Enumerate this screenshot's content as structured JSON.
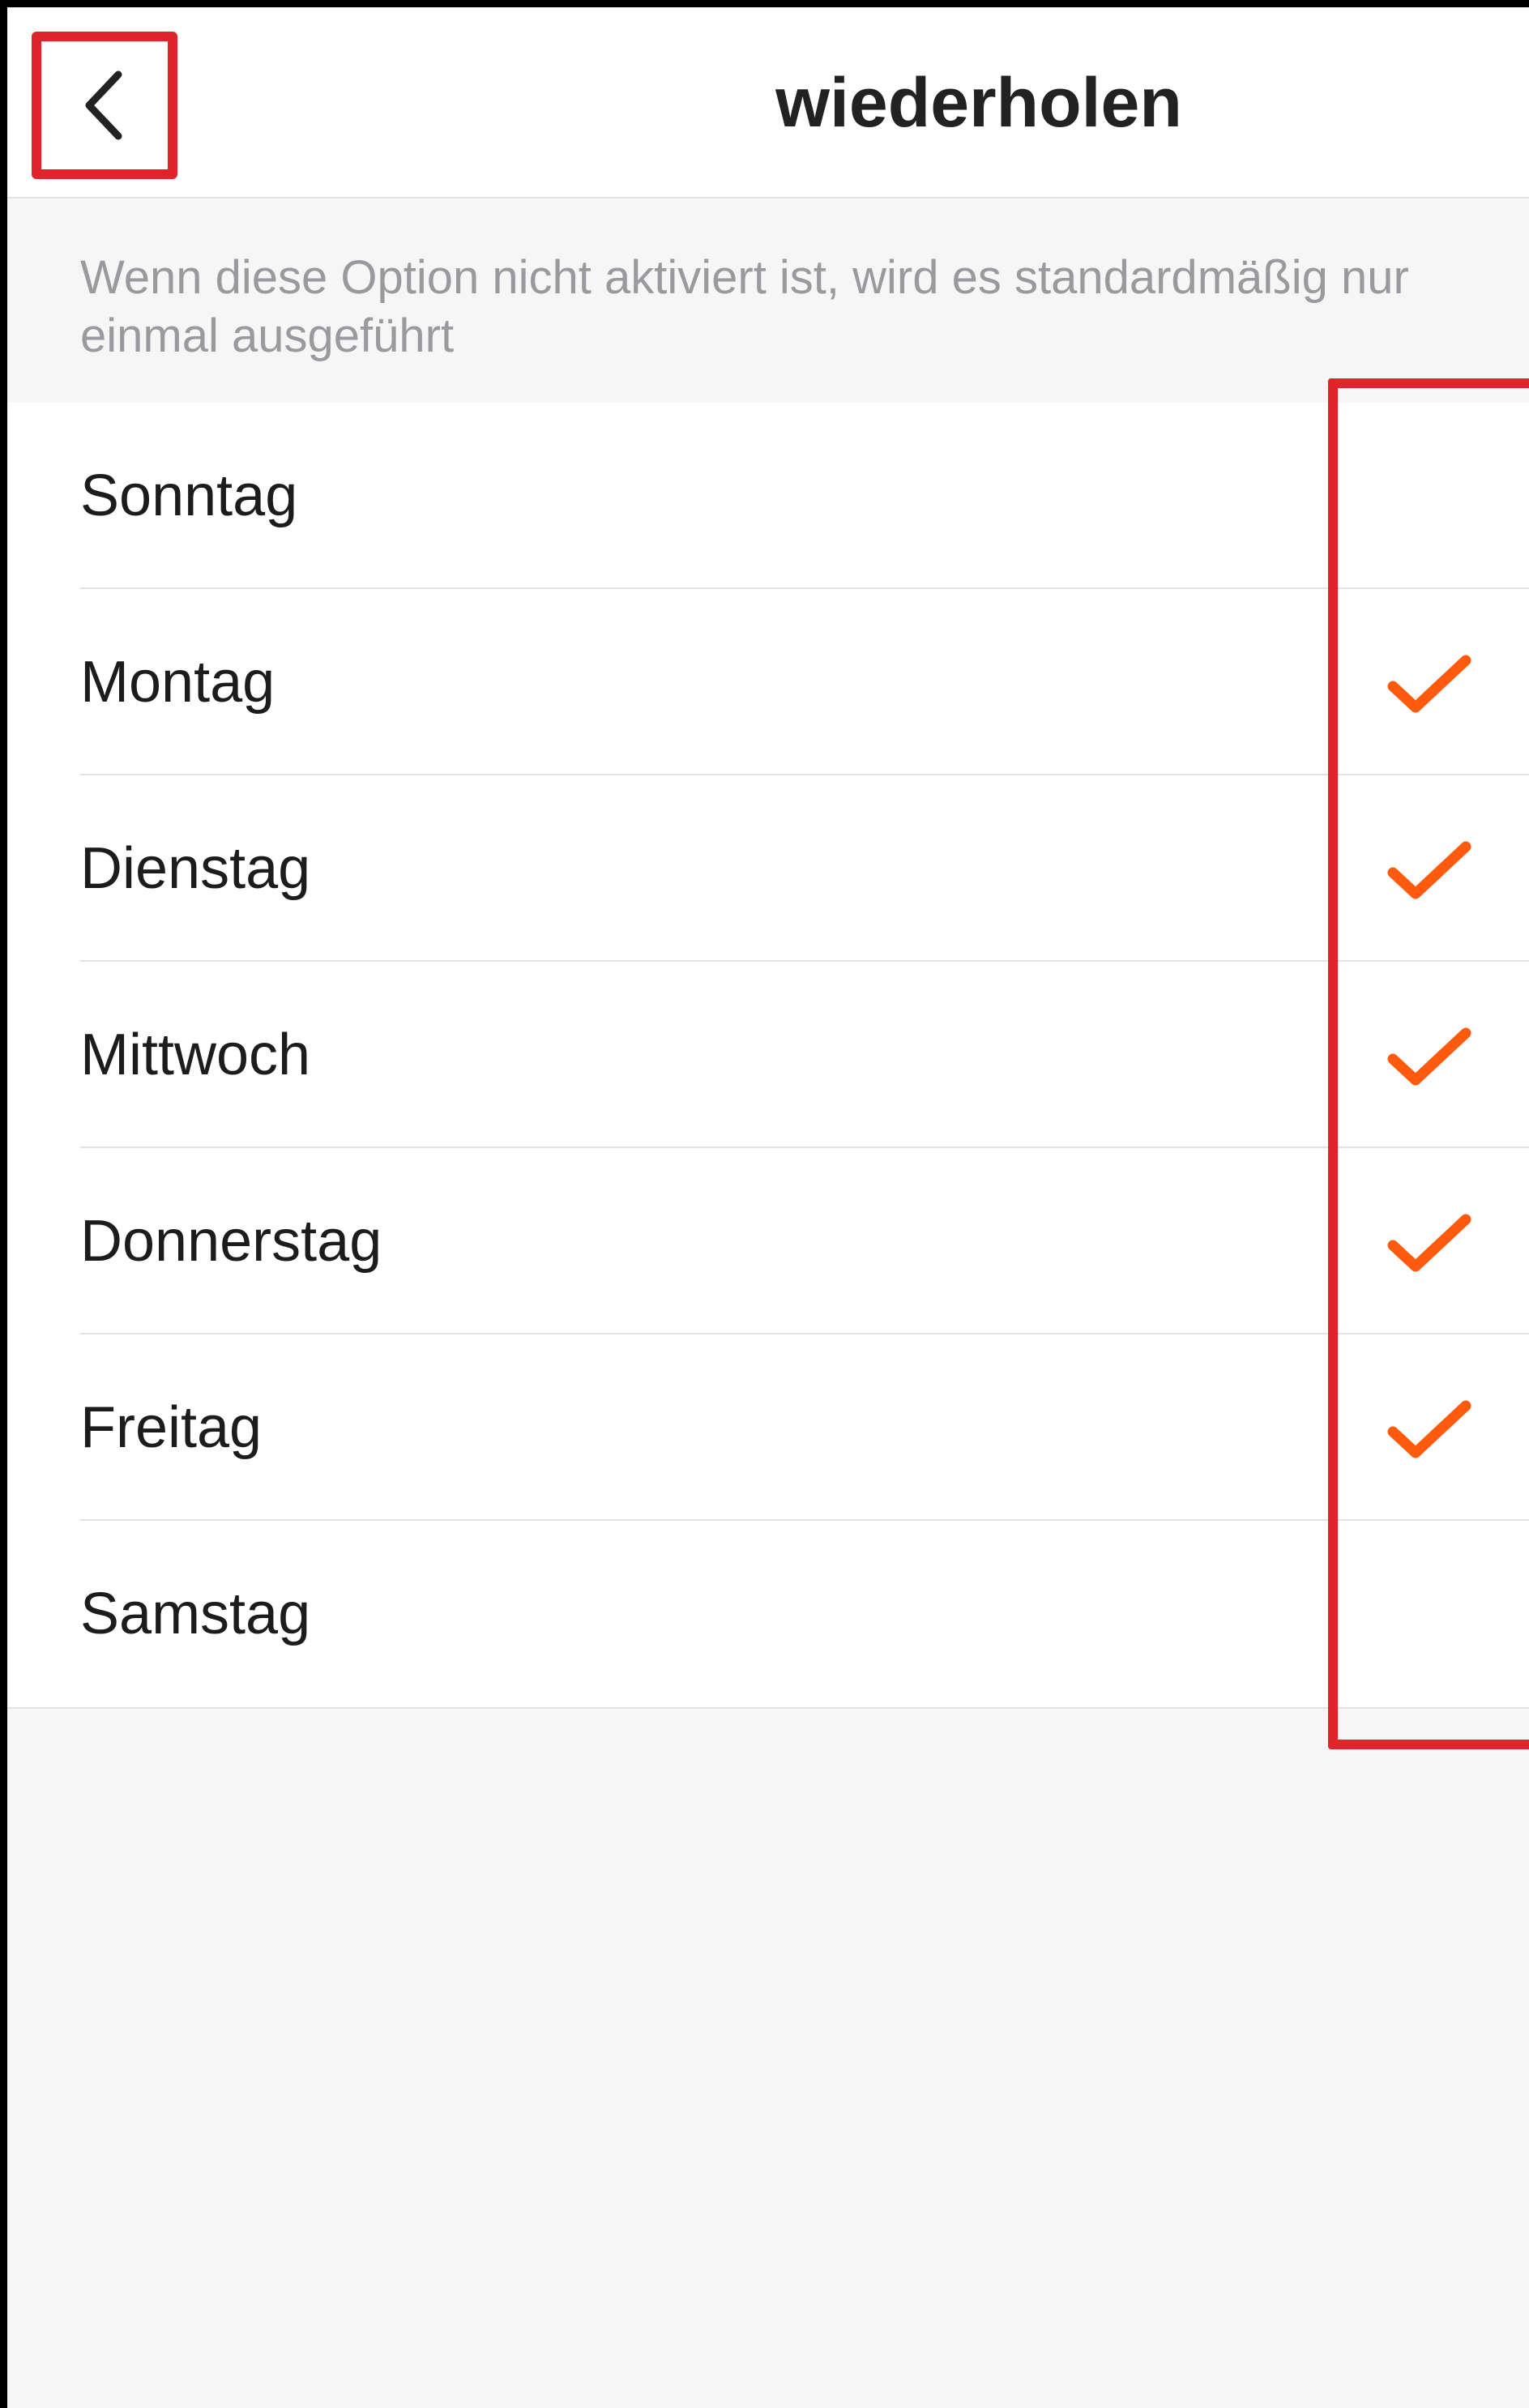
{
  "header": {
    "title": "wiederholen",
    "back_icon": "chevron-left-icon"
  },
  "hint": {
    "text": "Wenn diese Option nicht aktiviert ist, wird es standardmäßig nur einmal ausgeführt"
  },
  "days": [
    {
      "label": "Sonntag",
      "checked": false
    },
    {
      "label": "Montag",
      "checked": true
    },
    {
      "label": "Dienstag",
      "checked": true
    },
    {
      "label": "Mittwoch",
      "checked": true
    },
    {
      "label": "Donnerstag",
      "checked": true
    },
    {
      "label": "Freitag",
      "checked": true
    },
    {
      "label": "Samstag",
      "checked": false
    }
  ],
  "colors": {
    "check": "#ff5a0e",
    "highlight": "#e0242c",
    "title": "#222222",
    "hint": "#9a9a9e",
    "background": "#f6f6f6"
  }
}
